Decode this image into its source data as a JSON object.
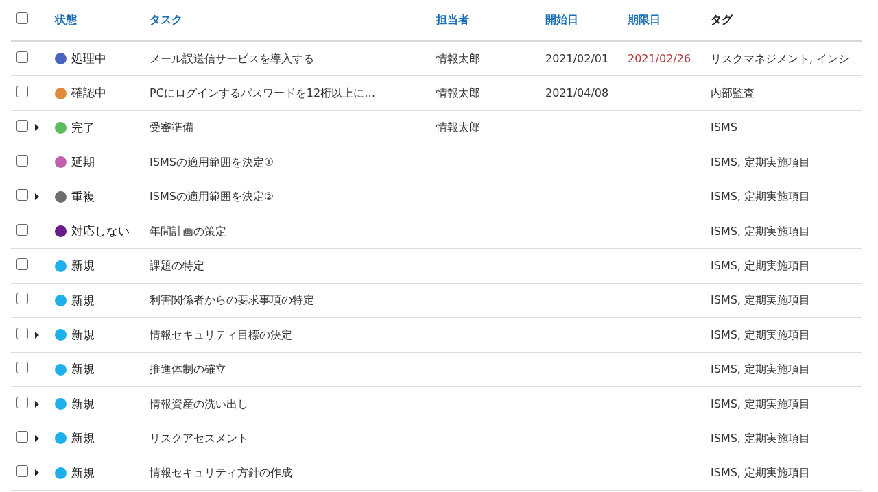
{
  "table": {
    "select_all": {
      "checked": false
    },
    "columns": [
      {
        "label": "状態",
        "sortable": true
      },
      {
        "label": "タスク",
        "sortable": true
      },
      {
        "label": "担当者",
        "sortable": true
      },
      {
        "label": "開始日",
        "sortable": true
      },
      {
        "label": "期限日",
        "sortable": true
      },
      {
        "label": "タグ",
        "sortable": false
      }
    ],
    "rows": [
      {
        "checked": false,
        "has_children": false,
        "status": "処理中",
        "color": "#4a63c0",
        "task": "メール誤送信サービスを導入する",
        "assignee": "情報太郎",
        "start": "2021/02/01",
        "due": "2021/02/26",
        "overdue": true,
        "tags": "リスクマネジメント, インシ"
      },
      {
        "checked": false,
        "has_children": false,
        "status": "確認中",
        "color": "#e08a3c",
        "task": "PCにログインするパスワードを12桁以上に…",
        "assignee": "情報太郎",
        "start": "2021/04/08",
        "tags": "内部監査"
      },
      {
        "checked": false,
        "has_children": true,
        "status": "完了",
        "color": "#5cbb5c",
        "task": "受審準備",
        "assignee": "情報太郎",
        "tags": "ISMS"
      },
      {
        "checked": false,
        "has_children": false,
        "status": "延期",
        "color": "#c05fad",
        "task": "ISMSの適用範囲を決定①",
        "tags": "ISMS, 定期実施項目"
      },
      {
        "checked": false,
        "has_children": true,
        "status": "重複",
        "color": "#6e6e6e",
        "task": "ISMSの適用範囲を決定②",
        "tags": "ISMS, 定期実施項目"
      },
      {
        "checked": false,
        "has_children": false,
        "status": "対応しない",
        "color": "#6a1b8a",
        "task": "年間計画の策定",
        "tags": "ISMS, 定期実施項目"
      },
      {
        "checked": false,
        "has_children": false,
        "status": "新規",
        "color": "#1eb0ea",
        "task": "課題の特定",
        "tags": "ISMS, 定期実施項目"
      },
      {
        "checked": false,
        "has_children": false,
        "status": "新規",
        "color": "#1eb0ea",
        "task": "利害関係者からの要求事項の特定",
        "tags": "ISMS, 定期実施項目"
      },
      {
        "checked": false,
        "has_children": true,
        "status": "新規",
        "color": "#1eb0ea",
        "task": "情報セキュリティ目標の決定",
        "tags": "ISMS, 定期実施項目"
      },
      {
        "checked": false,
        "has_children": false,
        "status": "新規",
        "color": "#1eb0ea",
        "task": "推進体制の確立",
        "tags": "ISMS, 定期実施項目"
      },
      {
        "checked": false,
        "has_children": true,
        "status": "新規",
        "color": "#1eb0ea",
        "task": "情報資産の洗い出し",
        "tags": "ISMS, 定期実施項目"
      },
      {
        "checked": false,
        "has_children": true,
        "status": "新規",
        "color": "#1eb0ea",
        "task": "リスクアセスメント",
        "tags": "ISMS, 定期実施項目"
      },
      {
        "checked": false,
        "has_children": true,
        "status": "新規",
        "color": "#1eb0ea",
        "task": "情報セキュリティ方針の作成",
        "tags": "ISMS, 定期実施項目"
      }
    ]
  }
}
